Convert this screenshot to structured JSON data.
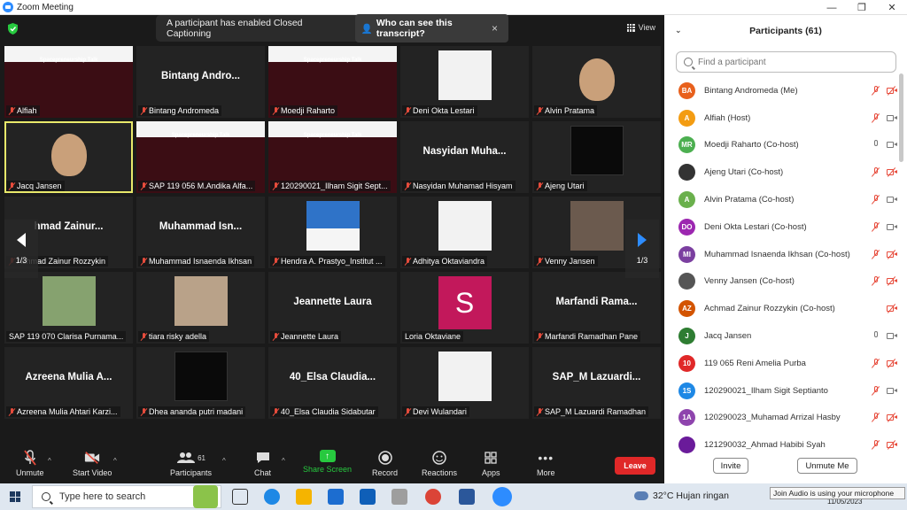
{
  "window": {
    "title": "Zoom Meeting"
  },
  "view_label": "View",
  "cc_banner": {
    "text": "A participant has enabled Closed Captioning",
    "who": "Who can see this transcript?",
    "close": "×"
  },
  "tiles": [
    {
      "name": "Alfiah",
      "kind": "poster",
      "poster_text": "Spacepreneurship Talk"
    },
    {
      "name": "Bintang Andromeda",
      "center": "Bintang  Andro...",
      "kind": "name"
    },
    {
      "name": "Moedji Raharto",
      "kind": "poster",
      "poster_text": "Spacepreneurship Talk"
    },
    {
      "name": "Deni Okta Lestari",
      "kind": "pic",
      "photo": "white"
    },
    {
      "name": "Alvin Pratama",
      "kind": "face"
    },
    {
      "name": "Jacq Jansen",
      "kind": "face",
      "active": true
    },
    {
      "name": "SAP 119 056 M.Andika Alfa...",
      "kind": "poster",
      "poster_text": "Spacepreneurship Talk"
    },
    {
      "name": "120290021_Ilham Sigit Sept...",
      "kind": "poster",
      "poster_text": "Spacepreneurship Talk"
    },
    {
      "name": "Nasyidan Muhamad Hisyam",
      "center": "Nasyidan  Muha...",
      "kind": "name"
    },
    {
      "name": "Ajeng Utari",
      "kind": "pic",
      "photo": "dark"
    },
    {
      "name": "Achmad Zainur Rozzykin",
      "center": "hmad  Zainur...",
      "kind": "name"
    },
    {
      "name": "Muhammad Isnaenda Ikhsan",
      "center": "Muhammad  Isn...",
      "kind": "name"
    },
    {
      "name": "Hendra A. Prastyo_Institut ...",
      "kind": "pic",
      "photo": "blue"
    },
    {
      "name": "Adhitya Oktaviandra",
      "kind": "pic",
      "photo": "white"
    },
    {
      "name": "Venny Jansen",
      "kind": "pic",
      "photo": "group"
    },
    {
      "name": "SAP 119 070 Clarisa Purnama...",
      "kind": "pic",
      "photo": "green",
      "muted": false
    },
    {
      "name": "tiara risky adella",
      "kind": "pic",
      "photo": "brown"
    },
    {
      "name": "Jeannette Laura",
      "center": "Jeannette Laura",
      "kind": "name"
    },
    {
      "name": "Loria Oktaviane",
      "kind": "avatar",
      "letter": "S",
      "muted": false
    },
    {
      "name": "Marfandi Ramadhan Pane",
      "center": "Marfandi  Rama...",
      "kind": "name"
    },
    {
      "name": "Azreena Mulia Ahtari Karzi...",
      "center": "Azreena Mulia A...",
      "kind": "name"
    },
    {
      "name": "Dhea ananda putri madani",
      "kind": "pic",
      "photo": "dark"
    },
    {
      "name": "40_Elsa Claudia Sidabutar",
      "center": "40_Elsa  Claudia...",
      "kind": "name"
    },
    {
      "name": "Devi Wulandari",
      "kind": "pic",
      "photo": "white"
    },
    {
      "name": "SAP_M Lazuardi Ramadhan",
      "center": "SAP_M  Lazuardi...",
      "kind": "name"
    }
  ],
  "pager": {
    "left": "1/3",
    "right": "1/3"
  },
  "toolbar": {
    "unmute": "Unmute",
    "start_video": "Start Video",
    "participants": "Participants",
    "participants_count": "61",
    "chat": "Chat",
    "share_screen": "Share Screen",
    "record": "Record",
    "reactions": "Reactions",
    "apps": "Apps",
    "more": "More",
    "leave": "Leave"
  },
  "panel": {
    "title": "Participants (61)",
    "search_placeholder": "Find a participant",
    "invite": "Invite",
    "unmute_me": "Unmute Me",
    "participants": [
      {
        "initials": "BA",
        "color": "#e8601c",
        "name": "Bintang Andromeda (Me)",
        "mic": "off",
        "cam": "off"
      },
      {
        "initials": "A",
        "color": "#f39c12",
        "name": "Alfiah (Host)",
        "mic": "off",
        "cam": "on"
      },
      {
        "initials": "MR",
        "color": "#4caf50",
        "name": "Moedji Raharto (Co-host)",
        "mic": "on",
        "cam": "on"
      },
      {
        "initials": "",
        "color": "#333333",
        "name": "Ajeng Utari (Co-host)",
        "mic": "off",
        "cam": "off",
        "photo": true
      },
      {
        "initials": "A",
        "color": "#6ab04c",
        "name": "Alvin Pratama (Co-host)",
        "mic": "off",
        "cam": "on"
      },
      {
        "initials": "DO",
        "color": "#9c27b0",
        "name": "Deni Okta Lestari (Co-host)",
        "mic": "off",
        "cam": "on"
      },
      {
        "initials": "MI",
        "color": "#7b3fa0",
        "name": "Muhammad Isnaenda Ikhsan (Co-host)",
        "mic": "off",
        "cam": "off"
      },
      {
        "initials": "",
        "color": "#555555",
        "name": "Venny Jansen (Co-host)",
        "mic": "off",
        "cam": "off",
        "photo": true
      },
      {
        "initials": "AZ",
        "color": "#d35400",
        "name": "Achmad Zainur Rozzykin (Co-host)",
        "mic": "none",
        "cam": "off"
      },
      {
        "initials": "J",
        "color": "#2e7d32",
        "name": "Jacq Jansen",
        "mic": "on",
        "cam": "on"
      },
      {
        "initials": "10",
        "color": "#e02828",
        "name": "119 065 Reni Amelia Purba",
        "mic": "off",
        "cam": "off"
      },
      {
        "initials": "1S",
        "color": "#1e88e5",
        "name": "120290021_Ilham Sigit Septianto",
        "mic": "off",
        "cam": "on"
      },
      {
        "initials": "1A",
        "color": "#8e44ad",
        "name": "120290023_Muhamad Arrizal Hasby",
        "mic": "off",
        "cam": "off"
      },
      {
        "initials": "",
        "color": "#6a1b9a",
        "name": "121290032_Ahmad Habibi Syah",
        "mic": "off",
        "cam": "off",
        "photo": true
      }
    ]
  },
  "taskbar": {
    "search_placeholder": "Type here to search",
    "weather": "32°C  Hujan ringan",
    "date": "11/05/2023",
    "tooltip": "Join Audio is using your microphone"
  }
}
